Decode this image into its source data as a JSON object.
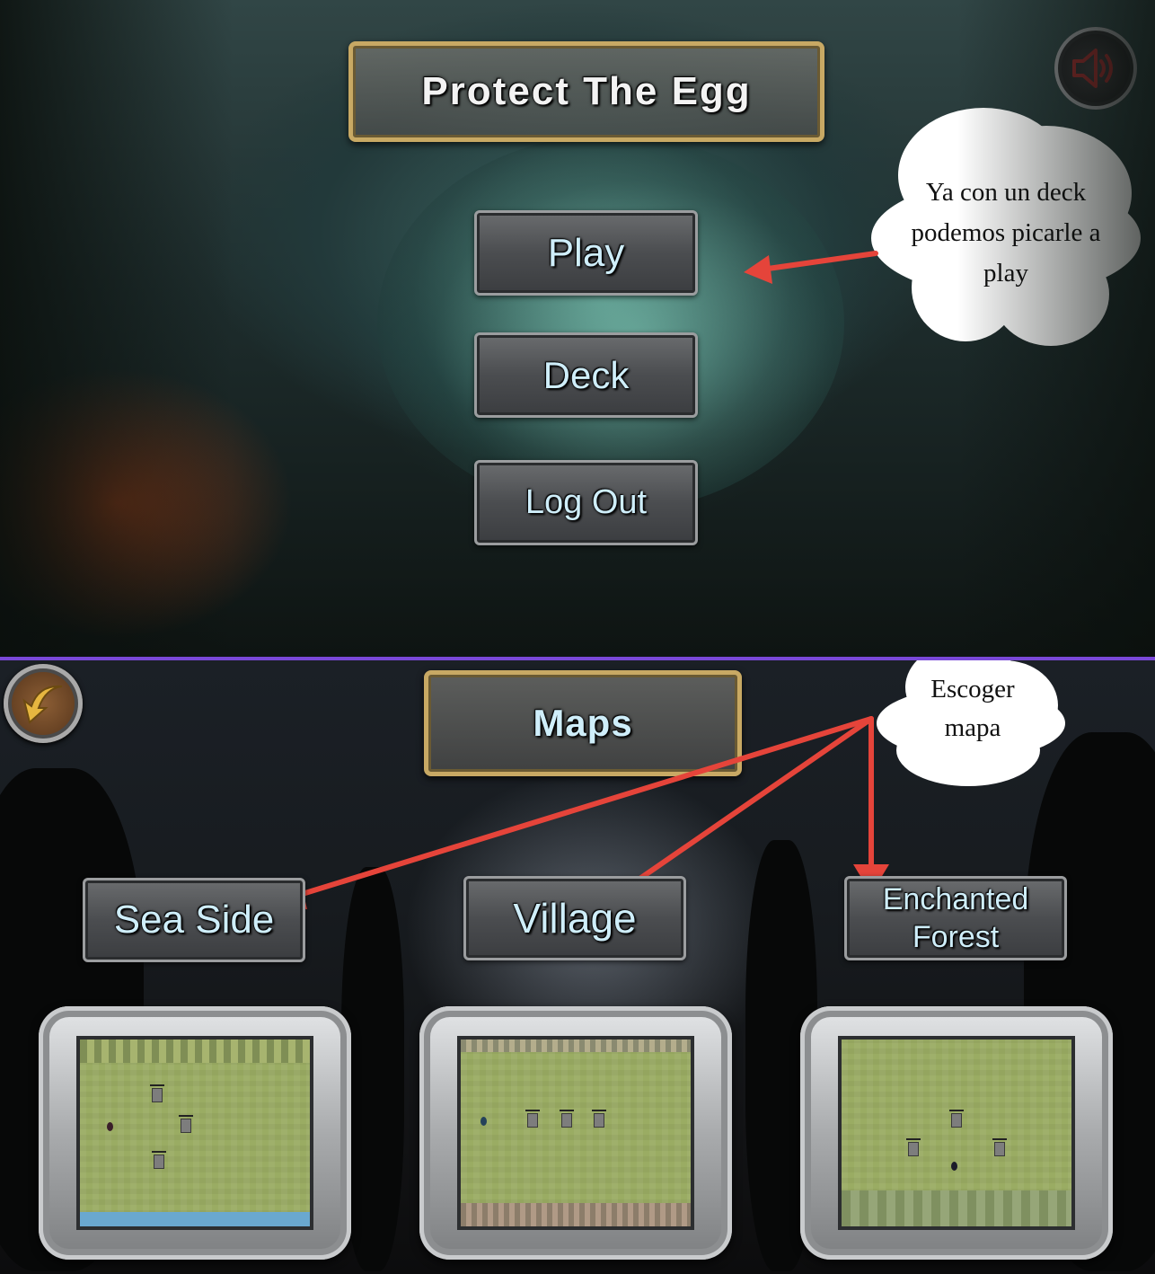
{
  "main_menu": {
    "title": "Protect The Egg",
    "buttons": [
      "Play",
      "Deck",
      "Log Out"
    ],
    "sound_icon": "speaker-icon",
    "annotation": "Ya con un deck podemos picarle a play"
  },
  "maps_screen": {
    "title": "Maps",
    "back_icon": "back-arrow-icon",
    "annotation_line1": "Escoger",
    "annotation_line2": "mapa",
    "maps": [
      {
        "label": "Sea Side"
      },
      {
        "label": "Village"
      },
      {
        "label": "Enchanted Forest"
      }
    ]
  },
  "colors": {
    "divider": "#7a48d8",
    "annotation_arrow": "#e5443a",
    "frame_gold": "#c8a964",
    "button_text": "#cfeefa"
  }
}
